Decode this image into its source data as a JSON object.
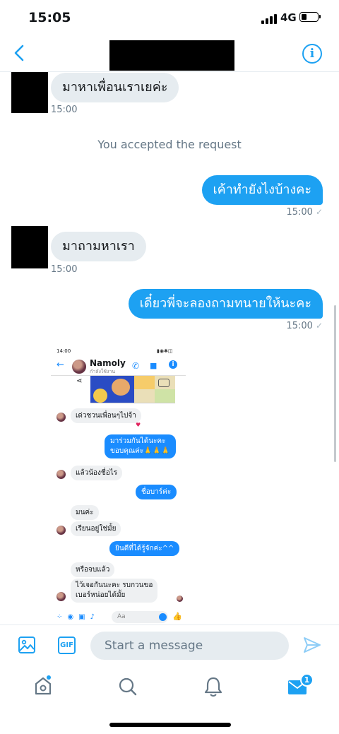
{
  "status_bar": {
    "time": "15:05",
    "network": "4G"
  },
  "thread": {
    "messages": [
      {
        "dir": "in",
        "text": "มาหาเพื่อนเราเยค่ะ",
        "time": "15:00"
      },
      {
        "dir": "system",
        "text": "You accepted the request"
      },
      {
        "dir": "out",
        "text": "เค้าทำยังไงบ้างคะ",
        "time": "15:00"
      },
      {
        "dir": "in",
        "text": "มาถามหาเรา",
        "time": "15:00"
      },
      {
        "dir": "out",
        "text": "เดี๋ยวพี่จะลองถามทนายให้นะคะ",
        "time": "15:00"
      }
    ]
  },
  "attachment": {
    "status_time": "14:00",
    "contact_name": "Namoly",
    "contact_status": "กำลังใช้งาน",
    "chat": [
      {
        "dir": "in",
        "text": "เด่วชวนเพื่อนๆไปจ้า",
        "reaction": "♥"
      },
      {
        "dir": "out",
        "lines": [
          "มาร่วมกันได้นะคะ",
          "ขอบคุณค่ะ🙏🙏🙏"
        ]
      },
      {
        "dir": "in",
        "text": "แล้วน้องชื่อไร"
      },
      {
        "dir": "out",
        "text": "ชื่อบาร์ค่ะ"
      },
      {
        "dir": "in",
        "text": "มนค่ะ"
      },
      {
        "dir": "in",
        "text": "เรียนอยู่ใช่มั้ย"
      },
      {
        "dir": "out",
        "text": "ยินดีที่ได้รู้จักค่ะ^^"
      },
      {
        "dir": "in",
        "text": "หรือจบแล้ว"
      },
      {
        "dir": "in",
        "lines": [
          "ไว้เจอกันนะคะ รบกวนขอ",
          "เบอร์หน่อยได้มั้ย"
        ]
      }
    ],
    "composer_placeholder": "Aa"
  },
  "composer": {
    "placeholder": "Start a message",
    "gif_label": "GIF"
  },
  "tab_bar": {
    "items": [
      "home-icon",
      "search-icon",
      "bell-icon",
      "mail-icon"
    ],
    "messages_badge": "1"
  },
  "colors": {
    "accent": "#1da1f2",
    "bubble_in": "#e6ecf0",
    "messenger_blue": "#1a8cff"
  }
}
